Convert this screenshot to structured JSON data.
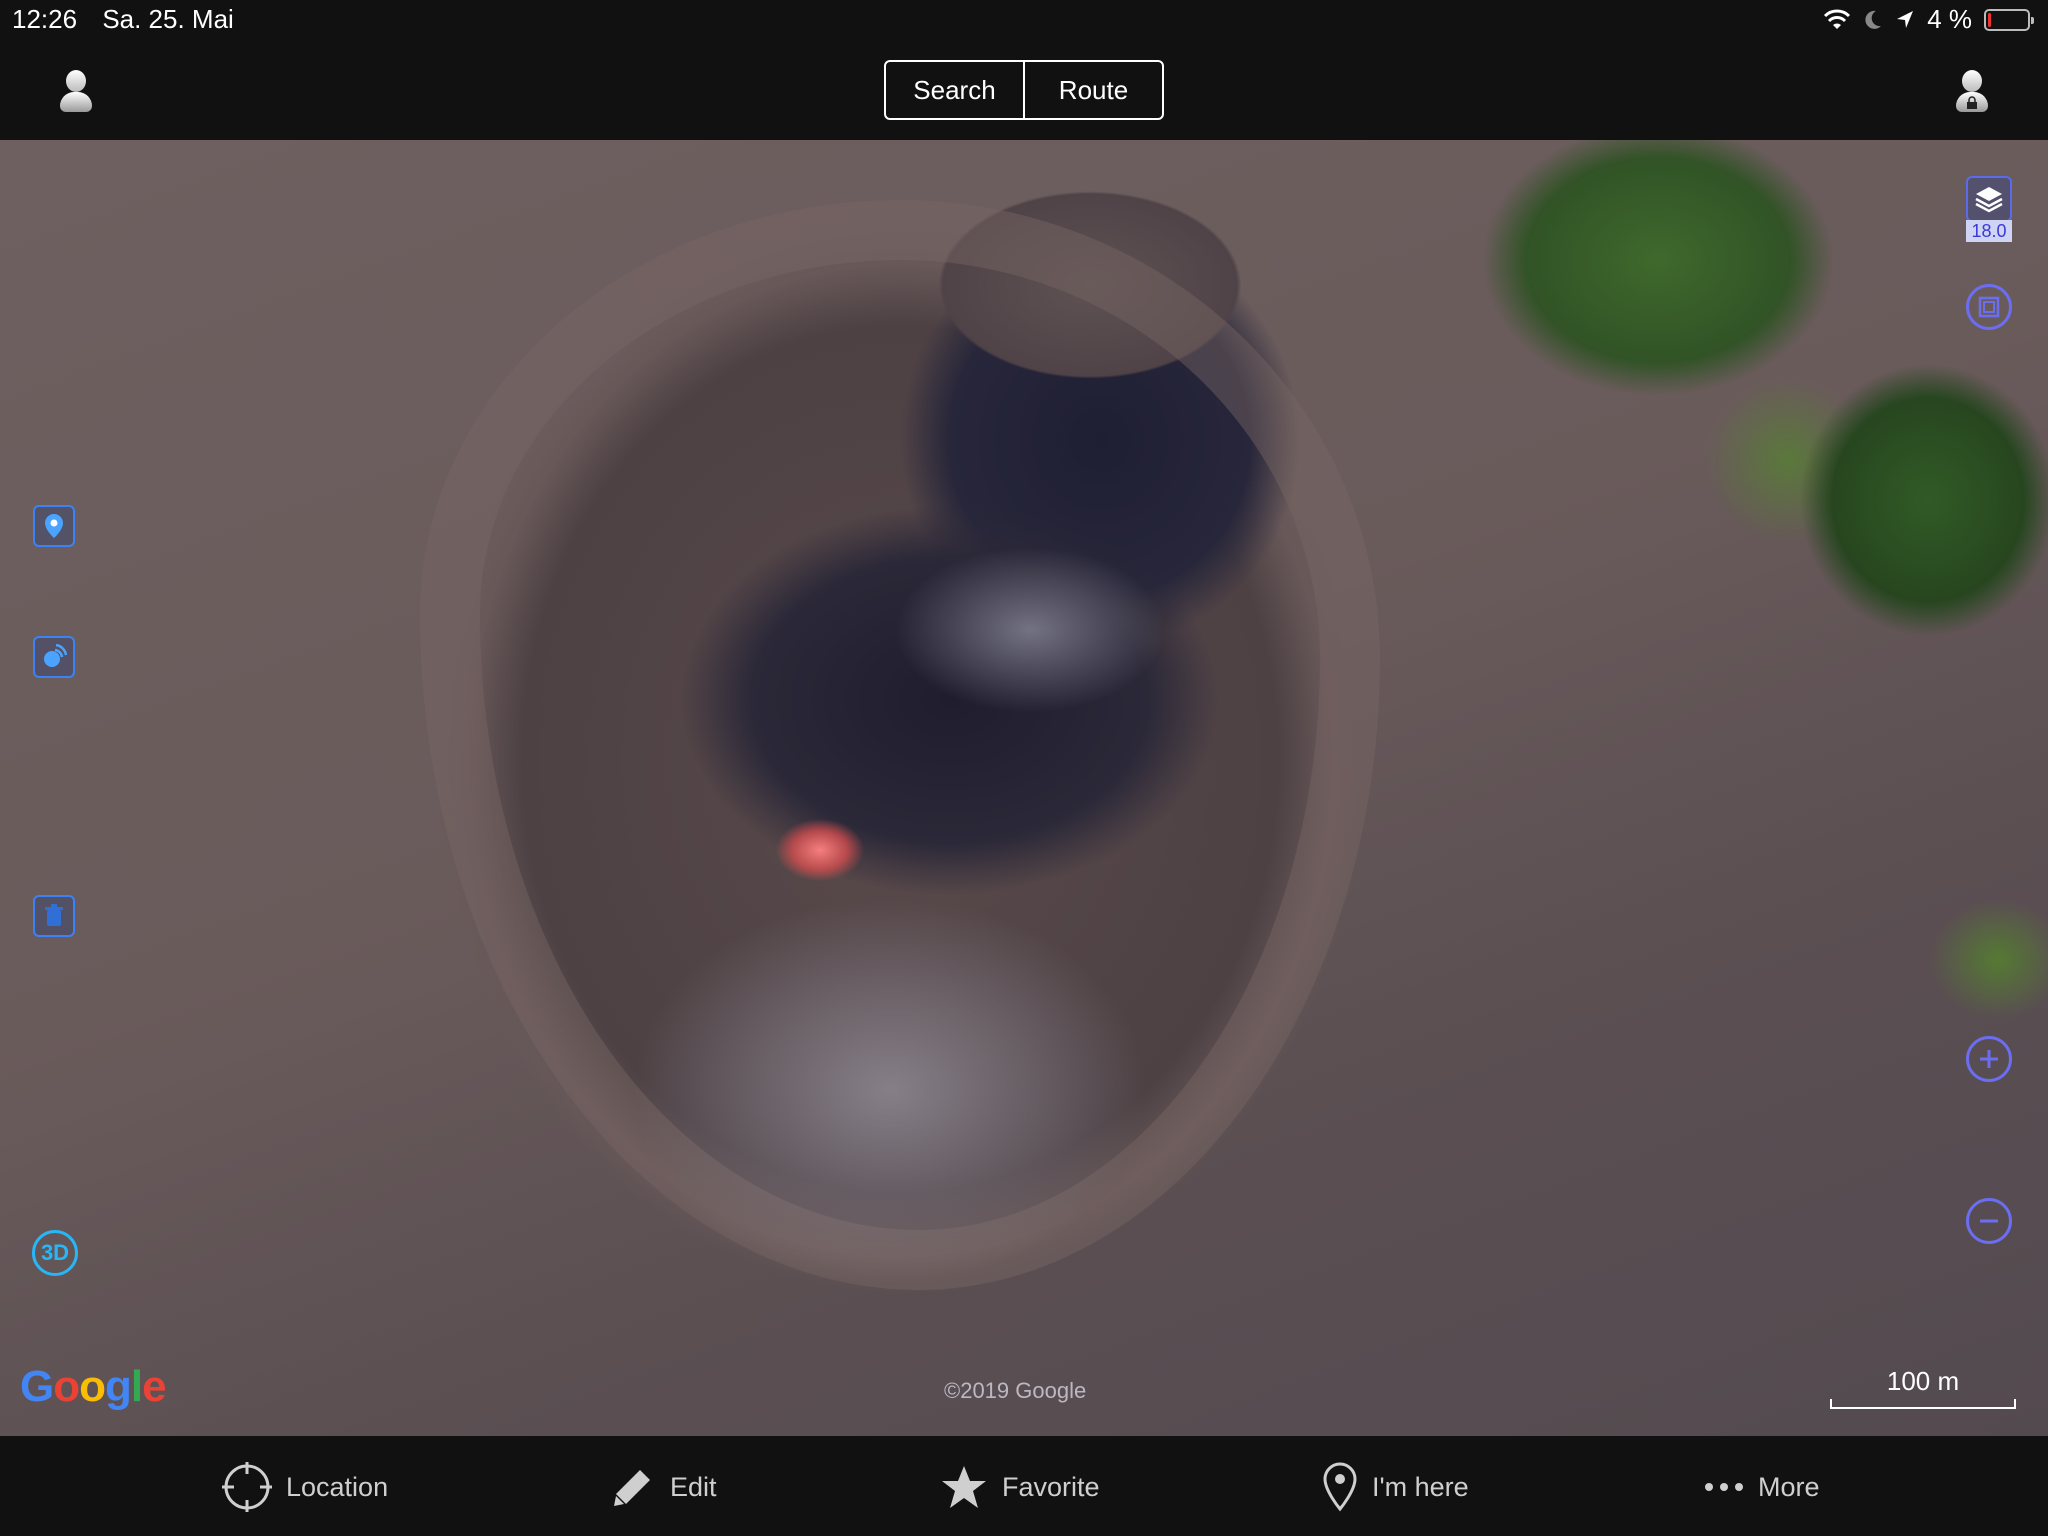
{
  "status": {
    "time": "12:26",
    "date": "Sa. 25. Mai",
    "battery": "4 %",
    "battery_level": 0.04
  },
  "nav": {
    "search_label": "Search",
    "route_label": "Route"
  },
  "map": {
    "zoom_level": "18.0",
    "copyright": "©2019 Google",
    "scale_label": "100 m",
    "provider": "Google",
    "mode_3d": "3D"
  },
  "toolbar": {
    "items": [
      {
        "label": "Location",
        "icon": "crosshair-icon"
      },
      {
        "label": "Edit",
        "icon": "pencil-icon"
      },
      {
        "label": "Favorite",
        "icon": "star-icon"
      },
      {
        "label": "I'm here",
        "icon": "pin-icon"
      },
      {
        "label": "More",
        "icon": "ellipsis-icon"
      }
    ]
  },
  "colors": {
    "accent_blue": "#3b82f6",
    "accent_purple": "#6b6ef0",
    "cyan": "#29b6f6"
  }
}
